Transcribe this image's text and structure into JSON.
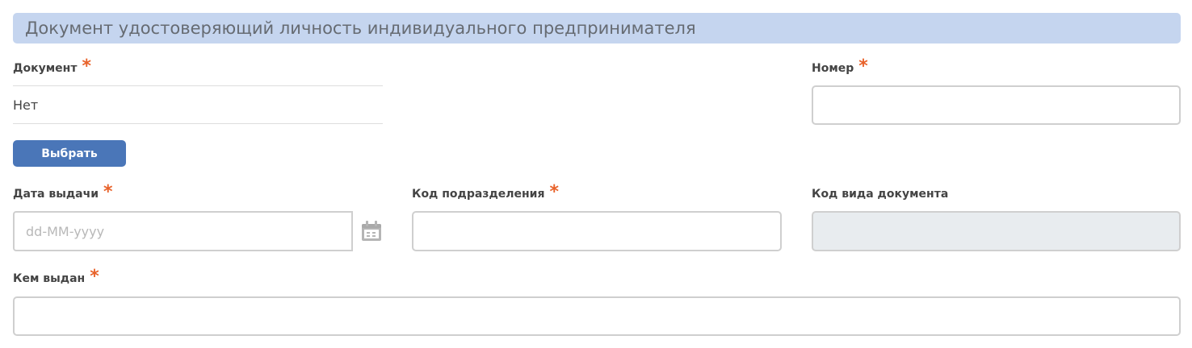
{
  "section": {
    "title": "Документ удостоверяющий личность индивидуального предпринимателя"
  },
  "fields": {
    "document": {
      "label": "Документ",
      "required_mark": "*",
      "value": "Нет",
      "select_button": "Выбрать"
    },
    "number": {
      "label": "Номер",
      "required_mark": "*",
      "value": ""
    },
    "issue_date": {
      "label": "Дата выдачи",
      "required_mark": "*",
      "placeholder": "dd-MM-yyyy",
      "value": "",
      "icon": "calendar-icon"
    },
    "division_code": {
      "label": "Код подразделения",
      "required_mark": "*",
      "value": ""
    },
    "document_type_code": {
      "label": "Код вида документа",
      "value": ""
    },
    "issued_by": {
      "label": "Кем выдан",
      "required_mark": "*",
      "value": ""
    }
  },
  "colors": {
    "header_bg": "#c5d5ef",
    "required": "#e8622a",
    "button": "#4a76b8",
    "readonly_bg": "#e8ecef"
  }
}
